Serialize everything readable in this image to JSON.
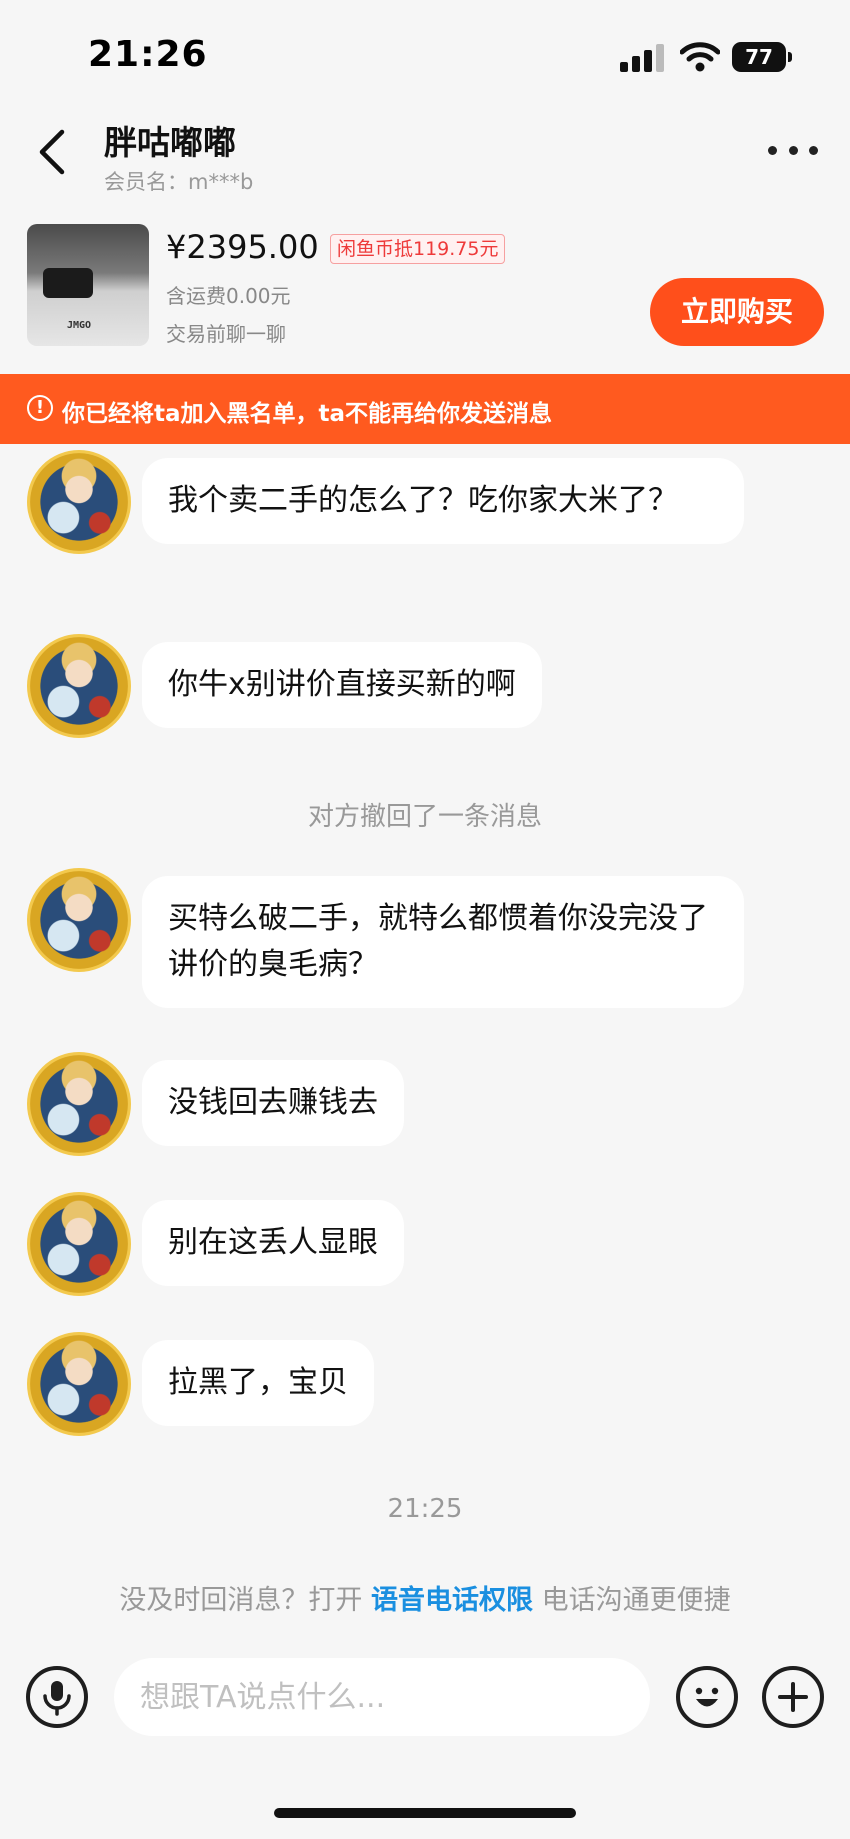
{
  "status_bar": {
    "time": "21:26",
    "battery": "77",
    "icons": [
      "signal-icon",
      "wifi-icon",
      "battery-icon"
    ]
  },
  "header": {
    "title": "胖咕嘟嘟",
    "subtitle": "会员名：m***b",
    "icons": [
      "back-icon",
      "more-icon"
    ]
  },
  "product": {
    "thumb_brand": "JMGO",
    "price": "¥2395.00",
    "coin_discount": "闲鱼币抵119.75元",
    "shipping": "含运费0.00元",
    "chat_first": "交易前聊一聊",
    "buy_label": "立即购买"
  },
  "banner": {
    "icon": "!",
    "text": "你已经将ta加入黑名单，ta不能再给你发送消息"
  },
  "messages": [
    {
      "type": "incoming",
      "text": "我个卖二手的怎么了？吃你家大米了？"
    },
    {
      "type": "incoming",
      "text": "你牛x别讲价直接买新的啊"
    },
    {
      "type": "system",
      "text": "对方撤回了一条消息"
    },
    {
      "type": "incoming",
      "text": "买特么破二手，就特么都惯着你没完没了讲价的臭毛病？"
    },
    {
      "type": "incoming",
      "text": "没钱回去赚钱去"
    },
    {
      "type": "incoming",
      "text": "别在这丢人显眼"
    },
    {
      "type": "incoming",
      "text": "拉黑了，宝贝"
    }
  ],
  "timestamp": "21:25",
  "permission_tip": {
    "prefix": "没及时回消息？打开",
    "link": "语音电话权限",
    "suffix": "电话沟通更便捷"
  },
  "input_bar": {
    "placeholder": "想跟TA说点什么...",
    "value": "",
    "icons": [
      "microphone-icon",
      "emoji-icon",
      "plus-icon"
    ]
  },
  "colors": {
    "accent": "#ff4f1b",
    "banner": "#ff5a1f",
    "link": "#1a8fe0",
    "badge_text": "#ee3a3a"
  }
}
